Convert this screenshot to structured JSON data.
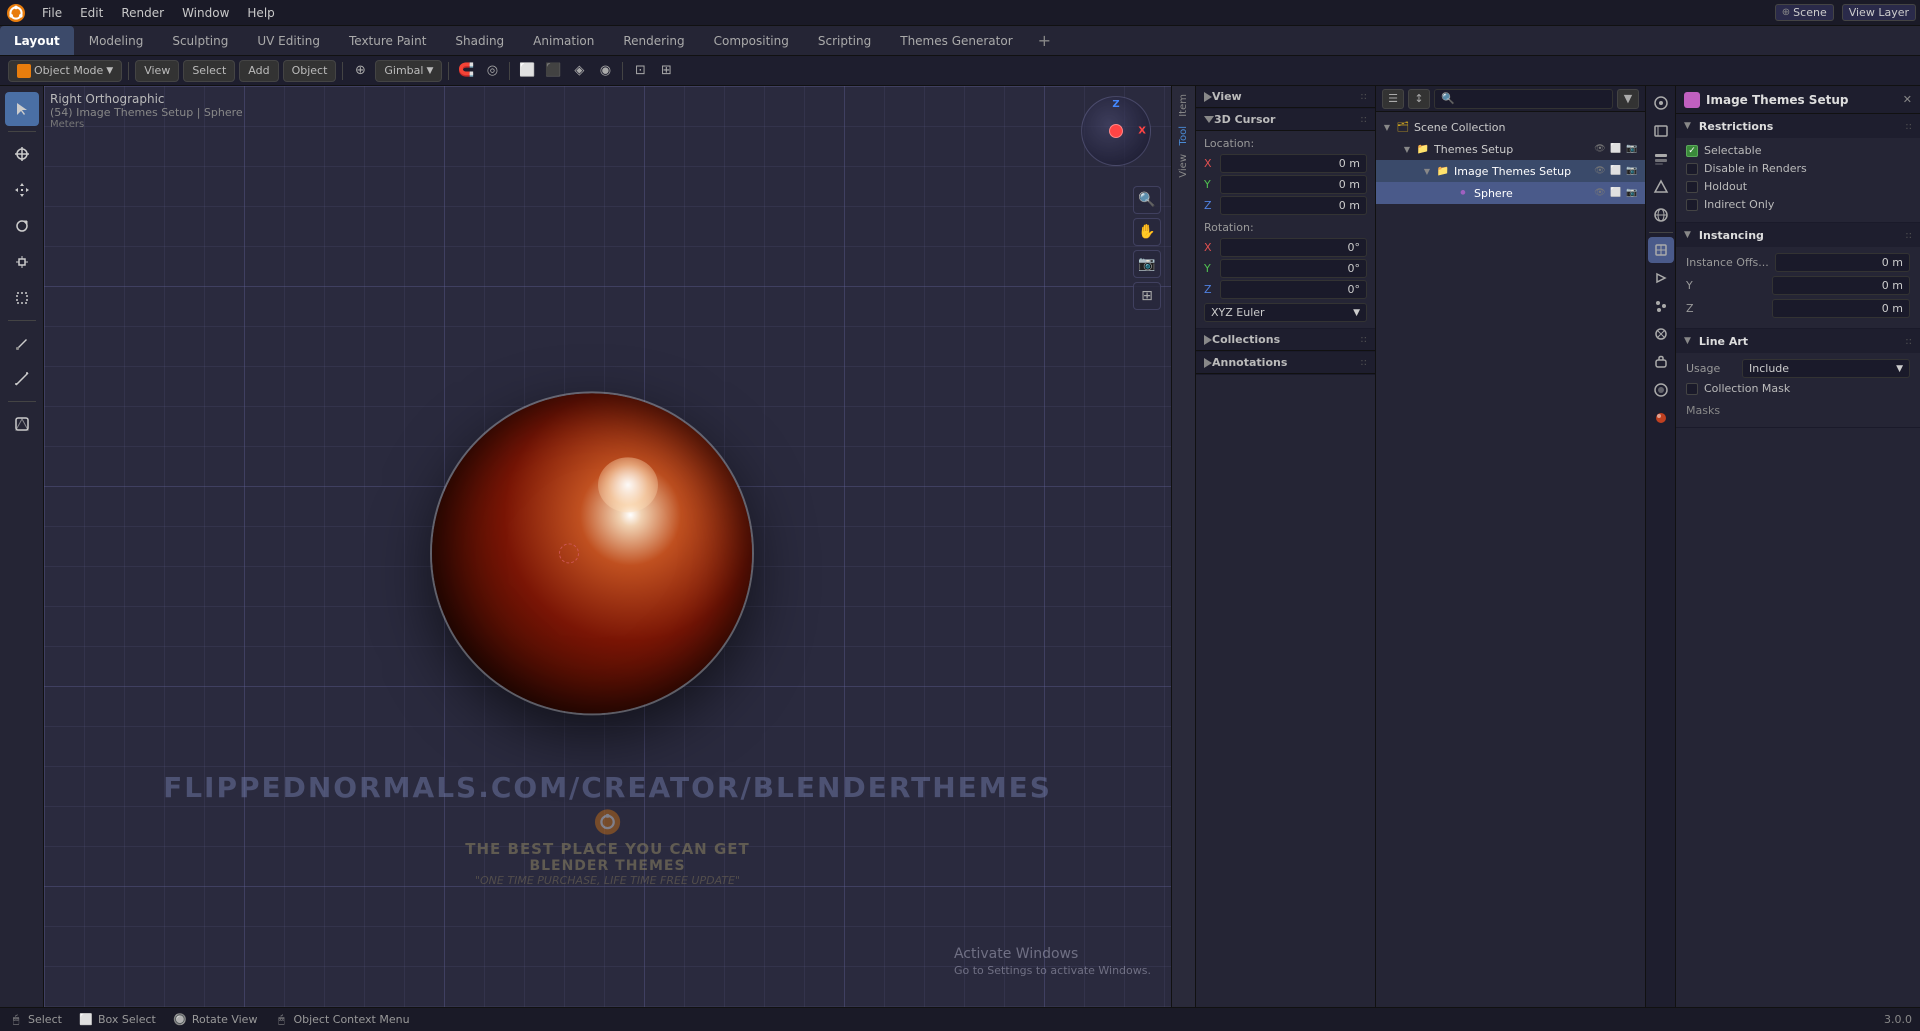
{
  "app": {
    "title": "Blender",
    "version": "3.0.0"
  },
  "topbar": {
    "menus": [
      "Blender",
      "File",
      "Edit",
      "Render",
      "Window",
      "Help"
    ],
    "layout_mode": "Layout"
  },
  "tabs": {
    "items": [
      {
        "label": "Layout",
        "active": true
      },
      {
        "label": "Modeling",
        "active": false
      },
      {
        "label": "Sculpting",
        "active": false
      },
      {
        "label": "UV Editing",
        "active": false
      },
      {
        "label": "Texture Paint",
        "active": false
      },
      {
        "label": "Shading",
        "active": false
      },
      {
        "label": "Animation",
        "active": false
      },
      {
        "label": "Rendering",
        "active": false
      },
      {
        "label": "Compositing",
        "active": false
      },
      {
        "label": "Scripting",
        "active": false
      },
      {
        "label": "Themes Generator",
        "active": false
      }
    ],
    "add_label": "+"
  },
  "header_toolbar": {
    "object_mode": "Object Mode",
    "view_label": "View",
    "select_label": "Select",
    "add_label": "Add",
    "object_label": "Object",
    "transform_label": "Gimbal",
    "pivot_icon": "◎"
  },
  "viewport": {
    "view_name": "Right Orthographic",
    "scene_info": "(54) Image Themes Setup | Sphere",
    "units": "Meters"
  },
  "properties_left": {
    "view_section": "View",
    "cursor_section": "3D Cursor",
    "location_label": "Location:",
    "location": {
      "x": "0 m",
      "y": "0 m",
      "z": "0 m"
    },
    "rotation_label": "Rotation:",
    "rotation": {
      "x": "0°",
      "y": "0°",
      "z": "0°"
    },
    "rotation_mode": "XYZ Euler",
    "collections_section": "Collections",
    "annotations_section": "Annotations"
  },
  "outliner": {
    "search_placeholder": "",
    "items": [
      {
        "name": "Scene Collection",
        "type": "scene",
        "level": 0,
        "icon": "🗂"
      },
      {
        "name": "Themes Setup",
        "type": "collection",
        "level": 1,
        "icon": "📁"
      },
      {
        "name": "Image Themes Setup",
        "type": "collection",
        "level": 2,
        "icon": "📁",
        "selected": true,
        "active": true
      },
      {
        "name": "Sphere",
        "type": "object",
        "level": 3,
        "icon": "⚫",
        "active": true
      }
    ]
  },
  "right_prop_panel": {
    "title": "Image Themes Setup",
    "restrictions": {
      "title": "Restrictions",
      "selectable": {
        "label": "Selectable",
        "checked": true
      },
      "disable_in_renders": {
        "label": "Disable in Renders",
        "checked": false
      },
      "holdout": {
        "label": "Holdout",
        "checked": false
      },
      "indirect_only": {
        "label": "Indirect Only",
        "checked": false
      }
    },
    "instancing": {
      "title": "Instancing",
      "instance_offset_label": "Instance Offs...",
      "x": "0 m",
      "y": "0 m",
      "z": "0 m"
    },
    "line_art": {
      "title": "Line Art",
      "usage_label": "Usage",
      "usage_value": "Include",
      "collection_mask": {
        "label": "Collection Mask",
        "checked": false
      },
      "masks_label": "Masks"
    }
  },
  "view_layer": {
    "label": "View Layer"
  },
  "side_strip": {
    "items": [
      "Item",
      "Tool",
      "View"
    ]
  },
  "status_bar": {
    "select_label": "Select",
    "select_icon": "🖱",
    "box_select_label": "Box Select",
    "rotate_label": "Rotate View",
    "context_menu_label": "Object Context Menu",
    "version": "3.0.0"
  },
  "watermark": {
    "url": "FLIPPEDNORMALS.COM/CREATOR/BLENDERTHEMES",
    "tagline1": "THE BEST PLACE YOU CAN GET",
    "tagline2": "BLENDER THEMES",
    "tagline3": "\"ONE TIME PURCHASE, LIFE TIME FREE UPDATE\""
  },
  "activate_windows": {
    "line1": "Activate Windows",
    "line2": "Go to Settings to activate Windows."
  },
  "prop_icons": {
    "icons": [
      "scene",
      "render",
      "output",
      "view-layer",
      "scene-data",
      "world",
      "object",
      "modifier",
      "particles",
      "physics",
      "constraints",
      "object-data",
      "material",
      "shading"
    ]
  }
}
